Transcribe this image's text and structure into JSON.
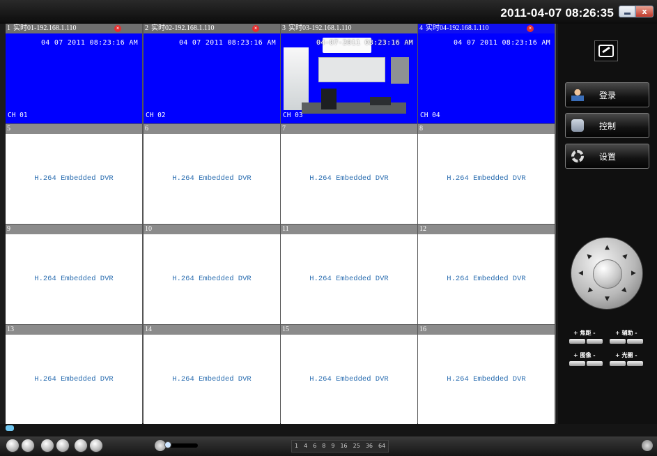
{
  "titlebar": {
    "datetime": "2011-04-07 08:26:35",
    "minimize": "",
    "close": "x"
  },
  "cells": [
    {
      "num": "1",
      "title": "实时01-192.168.1.110",
      "timestamp": "04 07 2011 08:23:16 AM",
      "channel": "CH 01",
      "type": "live"
    },
    {
      "num": "2",
      "title": "实时02-192.168.1.110",
      "timestamp": "04 07 2011 08:23:16 AM",
      "channel": "CH 02",
      "type": "live"
    },
    {
      "num": "3",
      "title": "实时03-192.168.1.110",
      "timestamp": "04-07-2011 08:23:16 AM",
      "channel": "CH 03",
      "type": "camera"
    },
    {
      "num": "4",
      "title": "实时04-192.168.1.110",
      "timestamp": "04 07 2011 08:23:16 AM",
      "channel": "CH 04",
      "type": "live"
    },
    {
      "num": "5",
      "text": "H.264 Embedded DVR"
    },
    {
      "num": "6",
      "text": "H.264 Embedded DVR"
    },
    {
      "num": "7",
      "text": "H.264 Embedded DVR"
    },
    {
      "num": "8",
      "text": "H.264 Embedded DVR"
    },
    {
      "num": "9",
      "text": "H.264 Embedded DVR"
    },
    {
      "num": "10",
      "text": "H.264 Embedded DVR"
    },
    {
      "num": "11",
      "text": "H.264 Embedded DVR"
    },
    {
      "num": "12",
      "text": "H.264 Embedded DVR"
    },
    {
      "num": "13",
      "text": "H.264 Embedded DVR"
    },
    {
      "num": "14",
      "text": "H.264 Embedded DVR"
    },
    {
      "num": "15",
      "text": "H.264 Embedded DVR"
    },
    {
      "num": "16",
      "text": "H.264 Embedded DVR"
    }
  ],
  "panel": {
    "login": "登录",
    "control": "控制",
    "settings": "设置",
    "ptz": {
      "focus": "+ 焦距 -",
      "aux": "+ 辅助 -",
      "image": "+ 图像 -",
      "iris": "+ 光圈 -"
    }
  },
  "splitter": [
    "1",
    "4",
    "6",
    "8",
    "9",
    "16",
    "25",
    "36",
    "64"
  ]
}
